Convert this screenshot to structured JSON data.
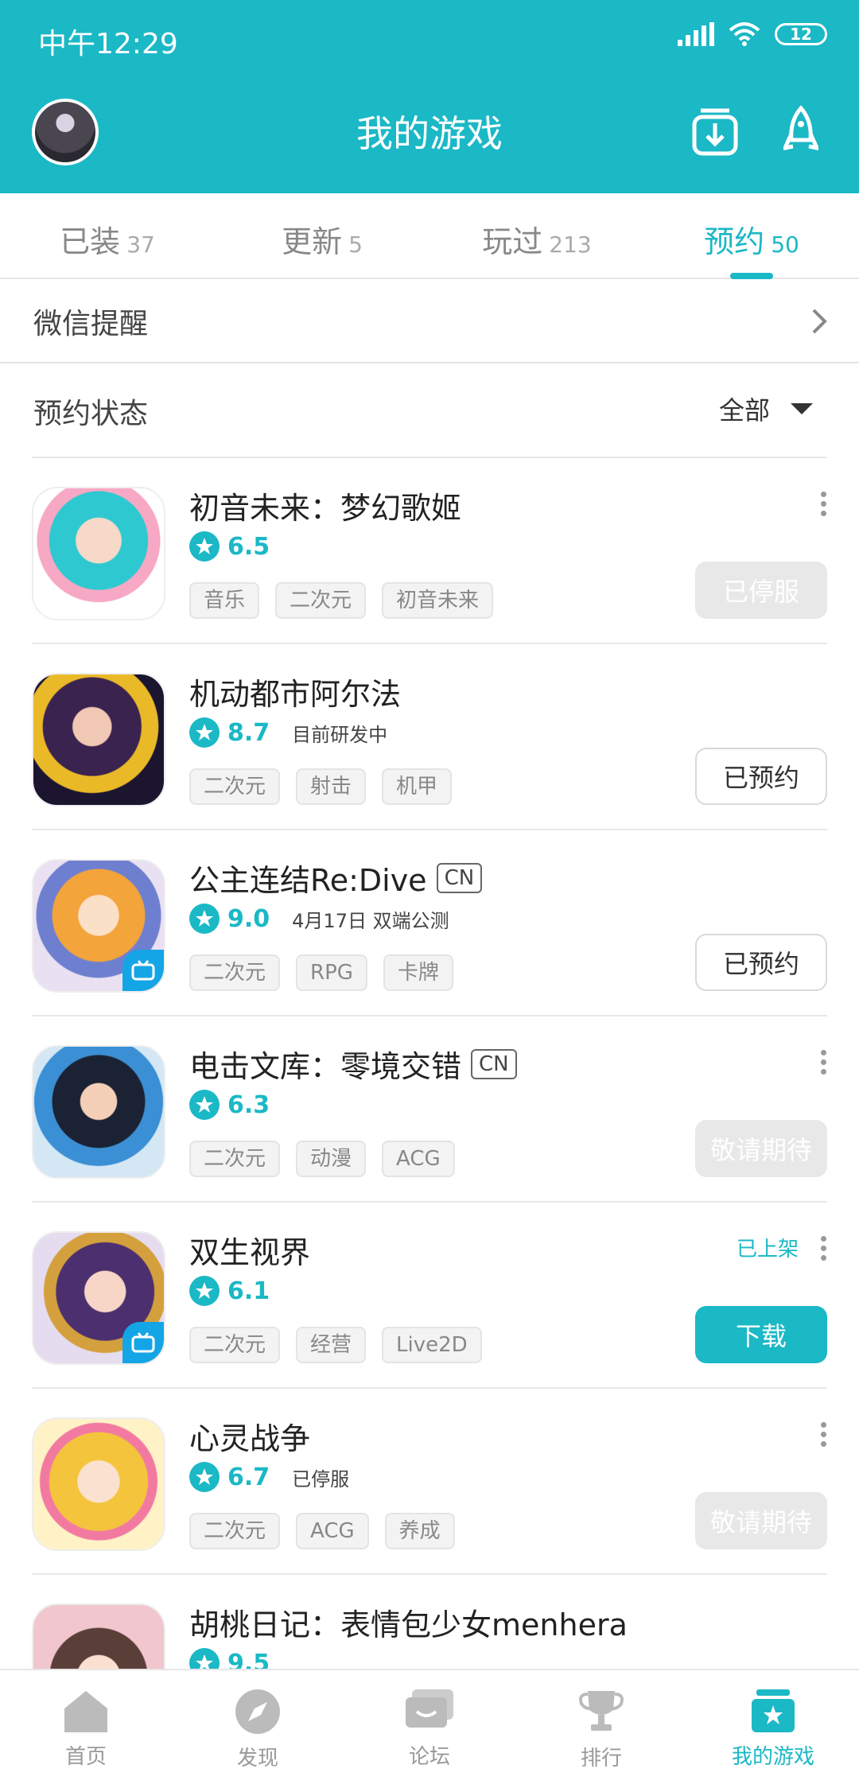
{
  "status_bar": {
    "time": "中午12:29",
    "battery": "12"
  },
  "header": {
    "title": "我的游戏"
  },
  "tabs": [
    {
      "label": "已装",
      "count": "37"
    },
    {
      "label": "更新",
      "count": "5"
    },
    {
      "label": "玩过",
      "count": "213"
    },
    {
      "label": "预约",
      "count": "50"
    }
  ],
  "wechat_reminder": {
    "label": "微信提醒"
  },
  "reservation_status": {
    "label": "预约状态",
    "filter": "全部"
  },
  "games": [
    {
      "title": "初音未来：梦幻歌姬",
      "cn": "",
      "score": "6.5",
      "note": "",
      "tags": [
        "音乐",
        "二次元",
        "初音未来"
      ],
      "on_shelf": "",
      "action": "已停服"
    },
    {
      "title": "机动都市阿尔法",
      "cn": "",
      "score": "8.7",
      "note": "目前研发中",
      "tags": [
        "二次元",
        "射击",
        "机甲"
      ],
      "on_shelf": "",
      "action": "已预约"
    },
    {
      "title": "公主连结Re:Dive",
      "cn": "CN",
      "score": "9.0",
      "note": "4月17日 双端公测",
      "tags": [
        "二次元",
        "RPG",
        "卡牌"
      ],
      "on_shelf": "",
      "action": "已预约"
    },
    {
      "title": "电击文库：零境交错",
      "cn": "CN",
      "score": "6.3",
      "note": "",
      "tags": [
        "二次元",
        "动漫",
        "ACG"
      ],
      "on_shelf": "",
      "action": "敬请期待"
    },
    {
      "title": "双生视界",
      "cn": "",
      "score": "6.1",
      "note": "",
      "tags": [
        "二次元",
        "经营",
        "Live2D"
      ],
      "on_shelf": "已上架",
      "action": "下载"
    },
    {
      "title": "心灵战争",
      "cn": "",
      "score": "6.7",
      "note": "已停服",
      "tags": [
        "二次元",
        "ACG",
        "养成"
      ],
      "on_shelf": "",
      "action": "敬请期待"
    },
    {
      "title": "胡桃日记：表情包少女menhera",
      "cn": "",
      "score": "9.5",
      "note": "",
      "tags": [],
      "on_shelf": "",
      "action": ""
    }
  ],
  "bottom_nav": [
    {
      "label": "首页",
      "icon": "home-icon"
    },
    {
      "label": "发现",
      "icon": "compass-icon"
    },
    {
      "label": "论坛",
      "icon": "forum-icon"
    },
    {
      "label": "排行",
      "icon": "trophy-icon"
    },
    {
      "label": "我的游戏",
      "icon": "my-games-icon"
    }
  ],
  "colors": {
    "accent": "#1bb8c6"
  }
}
